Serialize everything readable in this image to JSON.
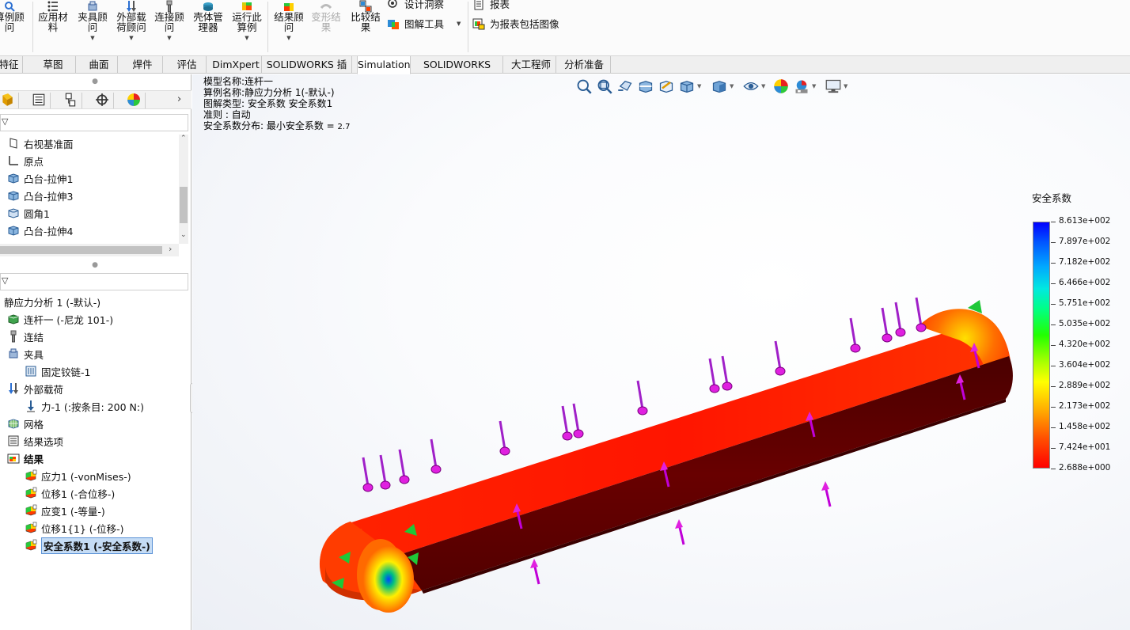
{
  "ribbon": {
    "buttons": [
      {
        "id": "study-advisor",
        "label": "算例顾\n问",
        "icon": "study-advisor-icon",
        "dropdown": false
      },
      {
        "id": "apply-material",
        "label": "应用材\n料",
        "icon": "apply-material-icon",
        "dropdown": false
      },
      {
        "id": "fixtures-advisor",
        "label": "夹具顾\n问",
        "icon": "fixtures-icon",
        "dropdown": true
      },
      {
        "id": "loads-advisor",
        "label": "外部载\n荷顾问",
        "icon": "external-loads-icon",
        "dropdown": true
      },
      {
        "id": "connections-advisor",
        "label": "连接顾\n问",
        "icon": "connections-icon",
        "dropdown": true
      },
      {
        "id": "shell-manager",
        "label": "壳体管\n理器",
        "icon": "shell-manager-icon",
        "dropdown": false
      },
      {
        "id": "run-study",
        "label": "运行此\n算例",
        "icon": "run-study-icon",
        "dropdown": true
      },
      {
        "id": "results-advisor",
        "label": "结果顾\n问",
        "icon": "results-advisor-icon",
        "dropdown": true
      },
      {
        "id": "deformed-result",
        "label": "变形结\n果",
        "icon": "deformed-result-icon",
        "dropdown": false,
        "disabled": true
      },
      {
        "id": "compare-results",
        "label": "比较结\n果",
        "icon": "compare-results-icon",
        "dropdown": false
      }
    ],
    "small": [
      {
        "id": "design-insight",
        "label": "设计洞察",
        "icon": "design-insight-icon"
      },
      {
        "id": "plot-tools",
        "label": "图解工具",
        "icon": "plot-tools-icon"
      },
      {
        "id": "report",
        "label": "报表",
        "icon": "report-icon"
      },
      {
        "id": "include-image",
        "label": "为报表包括图像",
        "icon": "include-image-icon"
      }
    ]
  },
  "tabs": [
    {
      "label": "特征",
      "active": false
    },
    {
      "label": "草图",
      "active": false
    },
    {
      "label": "曲面",
      "active": false
    },
    {
      "label": "焊件",
      "active": false
    },
    {
      "label": "评估",
      "active": false
    },
    {
      "label": "DimXpert",
      "active": false
    },
    {
      "label": "SOLIDWORKS 插件",
      "active": false
    },
    {
      "label": "Simulation",
      "active": true
    },
    {
      "label": "SOLIDWORKS MBD",
      "active": false
    },
    {
      "label": "大工程师",
      "active": false
    },
    {
      "label": "分析准备",
      "active": false
    }
  ],
  "panel_tabs": [
    {
      "icon": "feature-manager-icon"
    },
    {
      "icon": "property-manager-icon"
    },
    {
      "icon": "configuration-manager-icon"
    },
    {
      "icon": "dimxpert-manager-icon"
    },
    {
      "icon": "display-manager-icon"
    }
  ],
  "feature_tree": [
    {
      "label": "右视基准面",
      "icon": "plane-icon"
    },
    {
      "label": "原点",
      "icon": "origin-icon"
    },
    {
      "label": "凸台-拉伸1",
      "icon": "extrude-icon"
    },
    {
      "label": "凸台-拉伸3",
      "icon": "extrude-icon"
    },
    {
      "label": "圆角1",
      "icon": "fillet-icon"
    },
    {
      "label": "凸台-拉伸4",
      "icon": "extrude-icon"
    }
  ],
  "sim_tree": [
    {
      "label": "静应力分析 1 (-默认-)",
      "icon": "",
      "level": 0,
      "bold": false
    },
    {
      "label": "连杆一 (-尼龙 101-)",
      "icon": "part-material-icon",
      "level": 1,
      "bold": false
    },
    {
      "label": "连结",
      "icon": "connections-icon",
      "level": 1,
      "bold": false
    },
    {
      "label": "夹具",
      "icon": "fixtures-icon",
      "level": 1,
      "bold": false
    },
    {
      "label": "固定铰链-1",
      "icon": "fixed-hinge-icon",
      "level": 2,
      "bold": false
    },
    {
      "label": "外部载荷",
      "icon": "external-loads-icon",
      "level": 1,
      "bold": false
    },
    {
      "label": "力-1 (:按条目: 200 N:)",
      "icon": "force-icon",
      "level": 2,
      "bold": false
    },
    {
      "label": "网格",
      "icon": "mesh-icon",
      "level": 1,
      "bold": false
    },
    {
      "label": "结果选项",
      "icon": "result-options-icon",
      "level": 1,
      "bold": false
    },
    {
      "label": "结果",
      "icon": "results-folder-icon",
      "level": 1,
      "bold": true
    },
    {
      "label": "应力1 (-vonMises-)",
      "icon": "stress-plot-icon",
      "level": 2,
      "bold": false
    },
    {
      "label": "位移1 (-合位移-)",
      "icon": "displacement-plot-icon",
      "level": 2,
      "bold": false
    },
    {
      "label": "应变1 (-等量-)",
      "icon": "strain-plot-icon",
      "level": 2,
      "bold": false
    },
    {
      "label": "位移1{1} (-位移-)",
      "icon": "displacement-plot-icon",
      "level": 2,
      "bold": false
    },
    {
      "label": "安全系数1 (-安全系数-)",
      "icon": "factor-of-safety-icon",
      "level": 2,
      "bold": false,
      "selected": true
    }
  ],
  "viewport": {
    "info_lines": [
      {
        "label": "模型名称:连杆一",
        "value": ""
      },
      {
        "label": "算例名称:静应力分析 1(-默认-)",
        "value": ""
      },
      {
        "label": "图解类型: 安全系数 安全系数1",
        "value": ""
      },
      {
        "label": "准则 : 自动",
        "value": ""
      },
      {
        "label": "安全系数分布: 最小安全系数 = ",
        "value": "2.7"
      }
    ],
    "hud_icons": [
      "zoom-to-fit-icon",
      "zoom-area-icon",
      "previous-view-icon",
      "section-view-icon",
      "dynamic-annotation-icon",
      "view-orientation-icon",
      "display-style-icon",
      "hide-show-icon",
      "edit-appearance-icon",
      "apply-scene-icon",
      "view-settings-icon"
    ]
  },
  "legend": {
    "title": "安全系数",
    "values": [
      "8.613e+002",
      "7.897e+002",
      "7.182e+002",
      "6.466e+002",
      "5.751e+002",
      "5.035e+002",
      "4.320e+002",
      "3.604e+002",
      "2.889e+002",
      "2.173e+002",
      "1.458e+002",
      "7.424e+001",
      "2.688e+000"
    ],
    "colors": {
      "max": "#0000ff",
      "min": "#ff0000"
    }
  }
}
